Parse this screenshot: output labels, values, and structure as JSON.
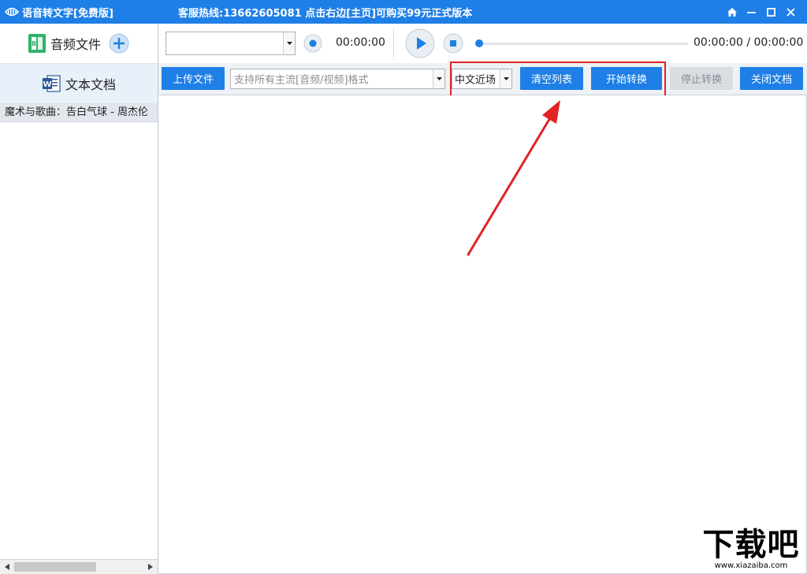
{
  "titlebar": {
    "app_title": "语音转文字[免费版]",
    "hotline": "客服热线:13662605081  点击右边[主页]可购买99元正式版本",
    "controls": [
      "home-icon",
      "minimize-icon",
      "maximize-icon",
      "close-icon"
    ]
  },
  "sidebar": {
    "nav": [
      {
        "label": "音频文件",
        "icon": "audio-file-icon"
      },
      {
        "label": "文本文档",
        "icon": "word-doc-icon"
      }
    ],
    "files": [
      "魔术与歌曲：告白气球 - 周杰伦"
    ]
  },
  "player": {
    "source_select": {
      "value": ""
    },
    "record_time": "00:00:00",
    "playback_time": "00:00:00 / 00:00:00",
    "progress": 0
  },
  "toolbar": {
    "upload": "上传文件",
    "format_placeholder": "支持所有主流[音频/视频]格式",
    "language": "中文近场",
    "clear": "清空列表",
    "start": "开始转换",
    "stop": "停止转换",
    "close_doc": "关闭文档"
  },
  "colors": {
    "accent": "#1e7fe6",
    "highlight": "#e02323"
  },
  "watermark": {
    "main": "下载吧",
    "url": "www.xiazaiba.com"
  }
}
